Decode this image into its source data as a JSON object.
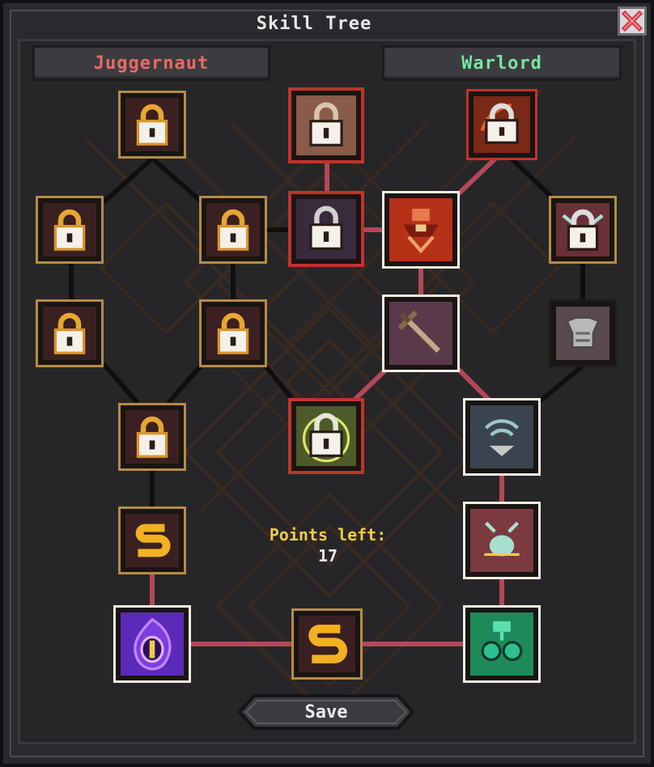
{
  "window": {
    "title": "Skill Tree",
    "close_icon": "close-x-icon"
  },
  "classes": {
    "left": "Juggernaut",
    "right": "Warlord"
  },
  "points": {
    "label": "Points left:",
    "value": "17"
  },
  "save_label": "Save",
  "colors": {
    "gold_frame": "#b58b46",
    "red_frame": "#c1332c",
    "white_frame": "#f3eee0",
    "link_active": "#b44758",
    "link_locked": "#0f0f10"
  },
  "nodes": [
    {
      "id": "j-lock-1",
      "icon": "lock-icon",
      "state": "locked"
    },
    {
      "id": "j-lock-2",
      "icon": "lock-icon",
      "state": "locked"
    },
    {
      "id": "j-lock-3",
      "icon": "lock-icon",
      "state": "locked"
    },
    {
      "id": "j-lock-4",
      "icon": "lock-icon",
      "state": "locked"
    },
    {
      "id": "j-lock-5",
      "icon": "lock-icon",
      "state": "locked"
    },
    {
      "id": "j-lock-6",
      "icon": "lock-icon",
      "state": "locked"
    },
    {
      "id": "j-s-node",
      "icon": "s-rune-icon",
      "state": "available"
    },
    {
      "id": "j-eye-node",
      "icon": "arcane-eye-icon",
      "state": "owned"
    },
    {
      "id": "c-lock-top",
      "icon": "lock-icon",
      "state": "locked-red"
    },
    {
      "id": "c-lock-mid",
      "icon": "lock-icon",
      "state": "locked-red"
    },
    {
      "id": "c-lock-low",
      "icon": "lock-icon",
      "state": "locked-red"
    },
    {
      "id": "c-s-node",
      "icon": "s-rune-icon",
      "state": "available"
    },
    {
      "id": "w-lock-fire",
      "icon": "lock-icon",
      "state": "locked-red"
    },
    {
      "id": "w-lock-beetle",
      "icon": "lock-icon",
      "state": "locked"
    },
    {
      "id": "w-warrior",
      "icon": "warrior-icon",
      "state": "owned"
    },
    {
      "id": "w-sword",
      "icon": "sword-icon",
      "state": "owned"
    },
    {
      "id": "w-armor",
      "icon": "armor-icon",
      "state": "available"
    },
    {
      "id": "w-shield",
      "icon": "shield-icon",
      "state": "owned"
    },
    {
      "id": "w-beetle",
      "icon": "beetle-icon",
      "state": "owned"
    },
    {
      "id": "w-orbs",
      "icon": "orbs-icon",
      "state": "owned"
    }
  ]
}
